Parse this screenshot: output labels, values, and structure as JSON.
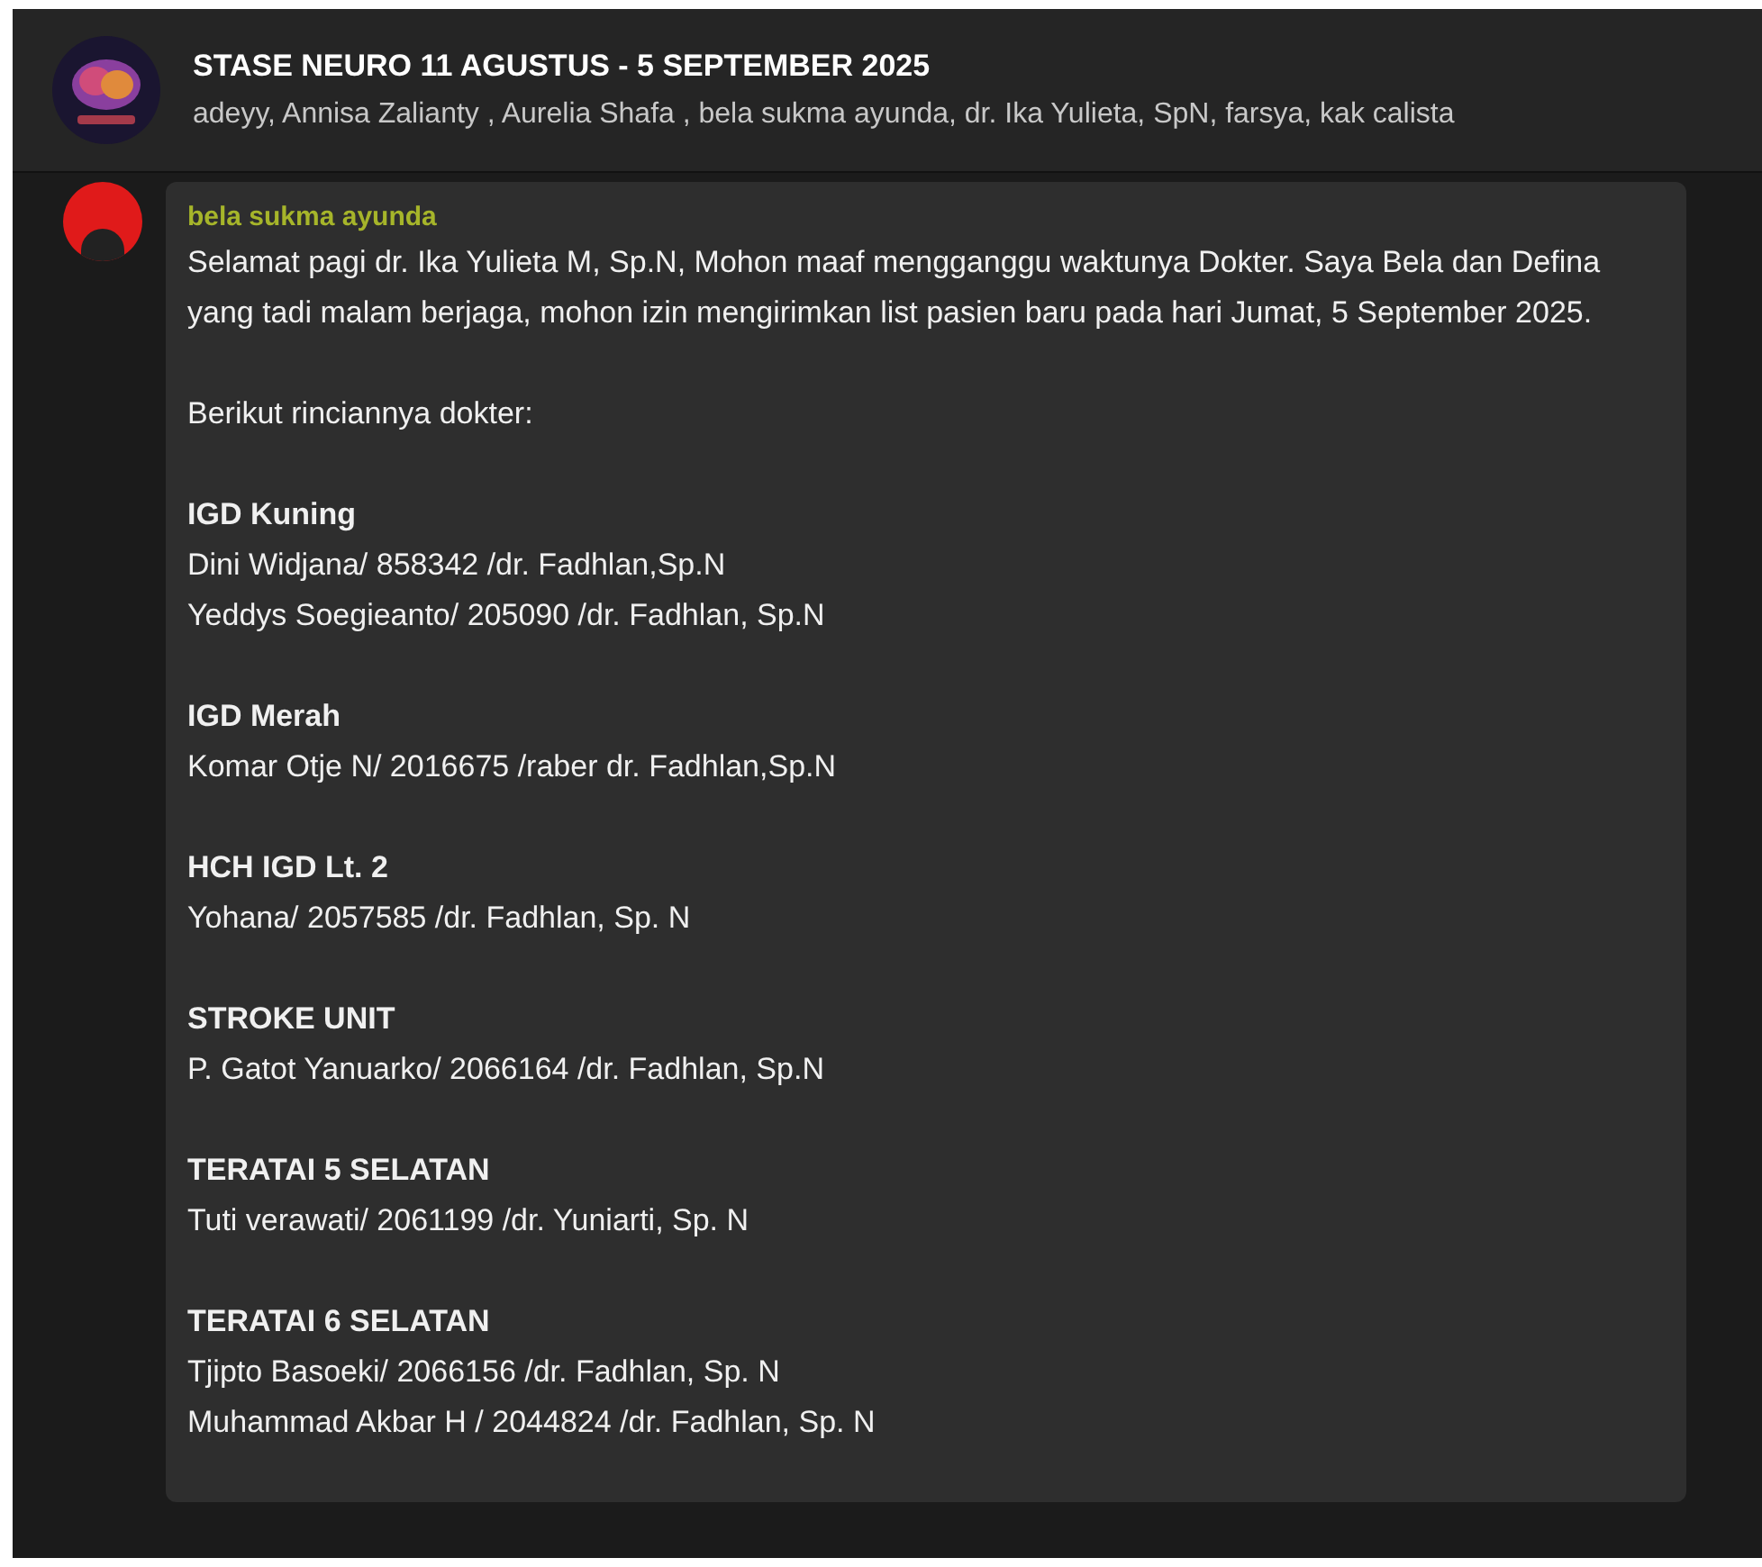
{
  "header": {
    "title": "STASE NEURO 11 AGUSTUS - 5 SEPTEMBER 2025",
    "members": "adeyy, Annisa Zalianty , Aurelia Shafa , bela sukma ayunda, dr. Ika Yulieta, SpN, farsya, kak calista"
  },
  "message": {
    "sender": "bela sukma ayunda",
    "blocks": [
      {
        "kind": "text",
        "lines": [
          "Selamat pagi dr. Ika Yulieta M, Sp.N, Mohon maaf mengganggu waktunya Dokter. Saya Bela dan Defina yang tadi malam berjaga, mohon izin mengirimkan list pasien baru pada hari Jumat, 5 September 2025."
        ]
      },
      {
        "kind": "text",
        "lines": [
          "Berikut rinciannya dokter:"
        ]
      },
      {
        "kind": "section",
        "heading": "IGD Kuning",
        "lines": [
          "Dini Widjana/ 858342 /dr. Fadhlan,Sp.N",
          "Yeddys Soegieanto/ 205090 /dr. Fadhlan, Sp.N"
        ]
      },
      {
        "kind": "section",
        "heading": "IGD Merah",
        "lines": [
          "Komar Otje N/ 2016675 /raber dr. Fadhlan,Sp.N"
        ]
      },
      {
        "kind": "section",
        "heading": "HCH IGD Lt. 2",
        "lines": [
          "Yohana/ 2057585 /dr. Fadhlan, Sp. N"
        ]
      },
      {
        "kind": "section",
        "heading": "STROKE UNIT",
        "lines": [
          "P. Gatot Yanuarko/ 2066164 /dr. Fadhlan, Sp.N"
        ]
      },
      {
        "kind": "section",
        "heading": "TERATAI 5 SELATAN",
        "lines": [
          "Tuti verawati/ 2061199 /dr. Yuniarti, Sp. N"
        ]
      },
      {
        "kind": "section",
        "heading": "TERATAI 6 SELATAN",
        "lines": [
          "Tjipto Basoeki/ 2066156 /dr. Fadhlan, Sp. N",
          "Muhammad Akbar H / 2044824 /dr. Fadhlan, Sp. N"
        ]
      }
    ]
  }
}
